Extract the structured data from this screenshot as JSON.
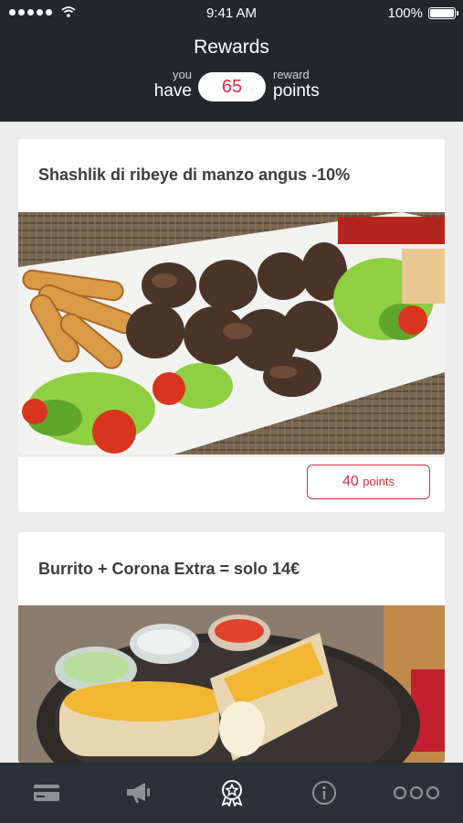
{
  "status_bar": {
    "time": "9:41 AM",
    "battery": "100%"
  },
  "header": {
    "title": "Rewards",
    "you_label": "you",
    "have_label": "have",
    "points_value": "65",
    "reward_label": "reward",
    "points_label": "points"
  },
  "rewards": [
    {
      "title": "Shashlik di ribeye di manzo angus -10%",
      "points_value": "40",
      "points_unit": "points",
      "image": "grilled beef skewers with potato wedges and salad"
    },
    {
      "title": "Burrito + Corona Extra = solo 14€",
      "image": "burrito with cheese and dipping sauces"
    }
  ],
  "tabbar": {
    "items": [
      {
        "icon": "card-icon",
        "active": false
      },
      {
        "icon": "megaphone-icon",
        "active": false
      },
      {
        "icon": "rewards-badge-icon",
        "active": true
      },
      {
        "icon": "info-icon",
        "active": false
      },
      {
        "icon": "more-icon",
        "active": false
      }
    ]
  },
  "colors": {
    "header_bg": "#23282b",
    "accent": "#d62f40",
    "tabbar_bg": "#2b3134"
  }
}
